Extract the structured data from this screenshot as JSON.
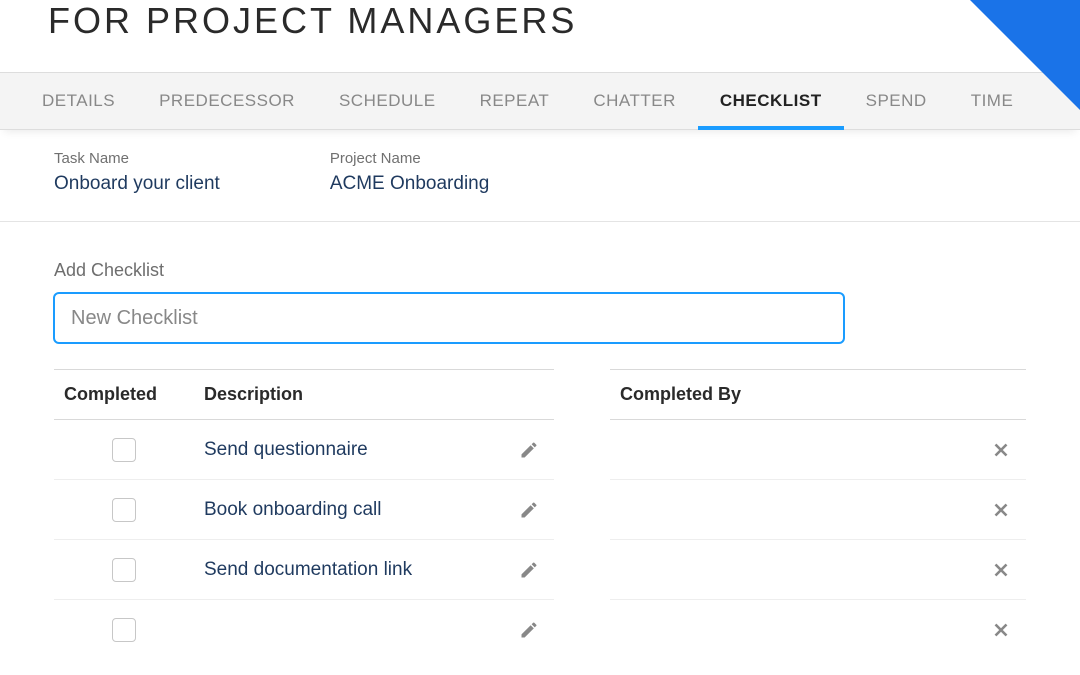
{
  "header": {
    "title": "FOR PROJECT MANAGERS"
  },
  "tabs": [
    {
      "label": "DETAILS",
      "active": false
    },
    {
      "label": "PREDECESSOR",
      "active": false
    },
    {
      "label": "SCHEDULE",
      "active": false
    },
    {
      "label": "REPEAT",
      "active": false
    },
    {
      "label": "CHATTER",
      "active": false
    },
    {
      "label": "CHECKLIST",
      "active": true
    },
    {
      "label": "SPEND",
      "active": false
    },
    {
      "label": "TIME",
      "active": false
    }
  ],
  "info": {
    "task_name_label": "Task Name",
    "task_name_value": "Onboard your client",
    "project_name_label": "Project Name",
    "project_name_value": "ACME Onboarding"
  },
  "checklist": {
    "add_label": "Add Checklist",
    "add_placeholder": "New Checklist",
    "columns": {
      "completed": "Completed",
      "description": "Description",
      "completed_by": "Completed By"
    },
    "items": [
      {
        "description": "Send questionnaire",
        "completed": false,
        "completed_by": ""
      },
      {
        "description": "Book onboarding call",
        "completed": false,
        "completed_by": ""
      },
      {
        "description": "Send documentation link",
        "completed": false,
        "completed_by": ""
      },
      {
        "description": "",
        "completed": false,
        "completed_by": ""
      }
    ]
  },
  "colors": {
    "accent": "#1a9cff",
    "ribbon": "#1a73e8",
    "link": "#1f3a5f"
  }
}
